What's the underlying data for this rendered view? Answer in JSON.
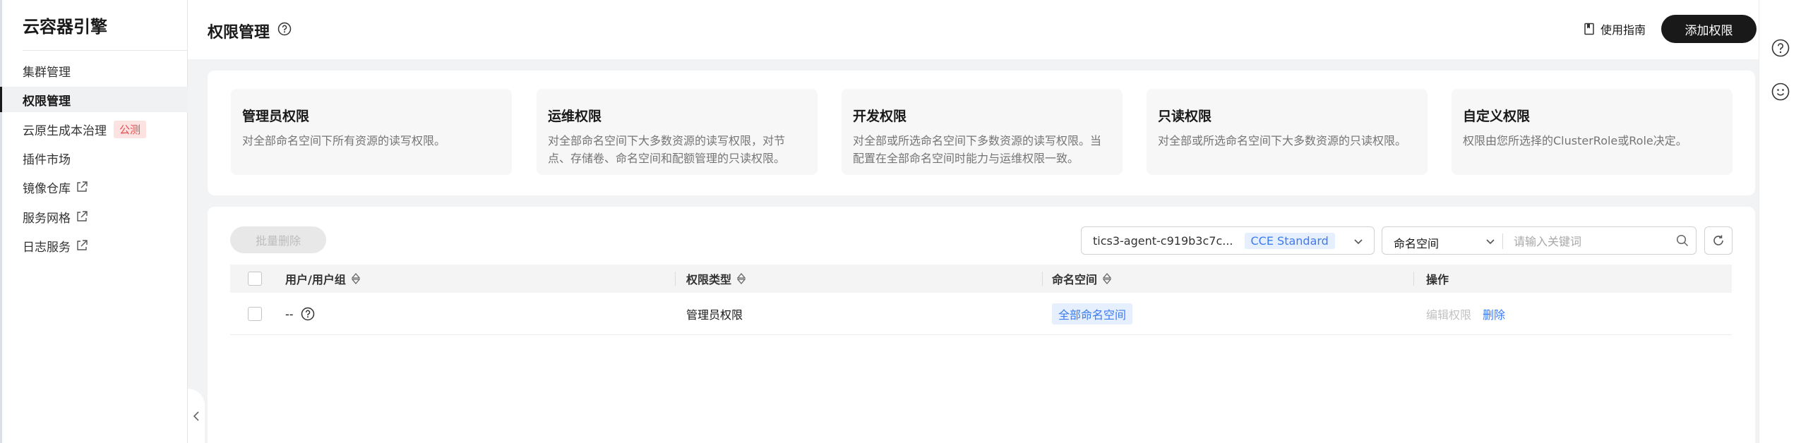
{
  "sidebar": {
    "title": "云容器引擎",
    "items": [
      {
        "label": "集群管理"
      },
      {
        "label": "权限管理"
      },
      {
        "label": "云原生成本治理",
        "badge": "公测"
      },
      {
        "label": "插件市场"
      },
      {
        "label": "镜像仓库"
      },
      {
        "label": "服务网格"
      },
      {
        "label": "日志服务"
      }
    ]
  },
  "header": {
    "title": "权限管理",
    "guide_label": "使用指南",
    "add_label": "添加权限"
  },
  "cards": [
    {
      "title": "管理员权限",
      "desc1": "对全部命名空间下所有资源的读写权限。",
      "desc2": ""
    },
    {
      "title": "运维权限",
      "desc1": "对全部命名空间下大多数资源的读写权限，对节",
      "desc2": "点、存储卷、命名空间和配额管理的只读权限。"
    },
    {
      "title": "开发权限",
      "desc1": "对全部或所选命名空间下多数资源的读写权限。当",
      "desc2": "配置在全部命名空间时能力与运维权限一致。"
    },
    {
      "title": "只读权限",
      "desc1": "对全部或所选命名空间下大多数资源的只读权限。",
      "desc2": ""
    },
    {
      "title": "自定义权限",
      "desc1": "权限由您所选择的ClusterRole或Role决定。",
      "desc2": ""
    }
  ],
  "toolbar": {
    "batch_delete": "批量删除",
    "cluster_name": "tics3-agent-c919b3c7c...",
    "cluster_type": "CCE Standard",
    "namespace_select": "命名空间",
    "search_placeholder": "请输入关键词"
  },
  "table": {
    "columns": [
      "用户/用户组",
      "权限类型",
      "命名空间",
      "操作"
    ],
    "rows": [
      {
        "user": "--",
        "type": "管理员权限",
        "namespace": "全部命名空间",
        "op_edit": "编辑权限",
        "op_delete": "删除"
      }
    ]
  },
  "colors": {
    "primary_dark": "#191919",
    "link_blue": "#3c7bf0",
    "tag_bg": "#e5effe",
    "beta_red": "#e84d4d"
  },
  "icons": [
    "help-icon",
    "book-icon",
    "external-link-icon",
    "chevron-down-icon",
    "search-icon",
    "refresh-icon",
    "sort-icon",
    "smile-icon",
    "chevron-left-icon"
  ]
}
